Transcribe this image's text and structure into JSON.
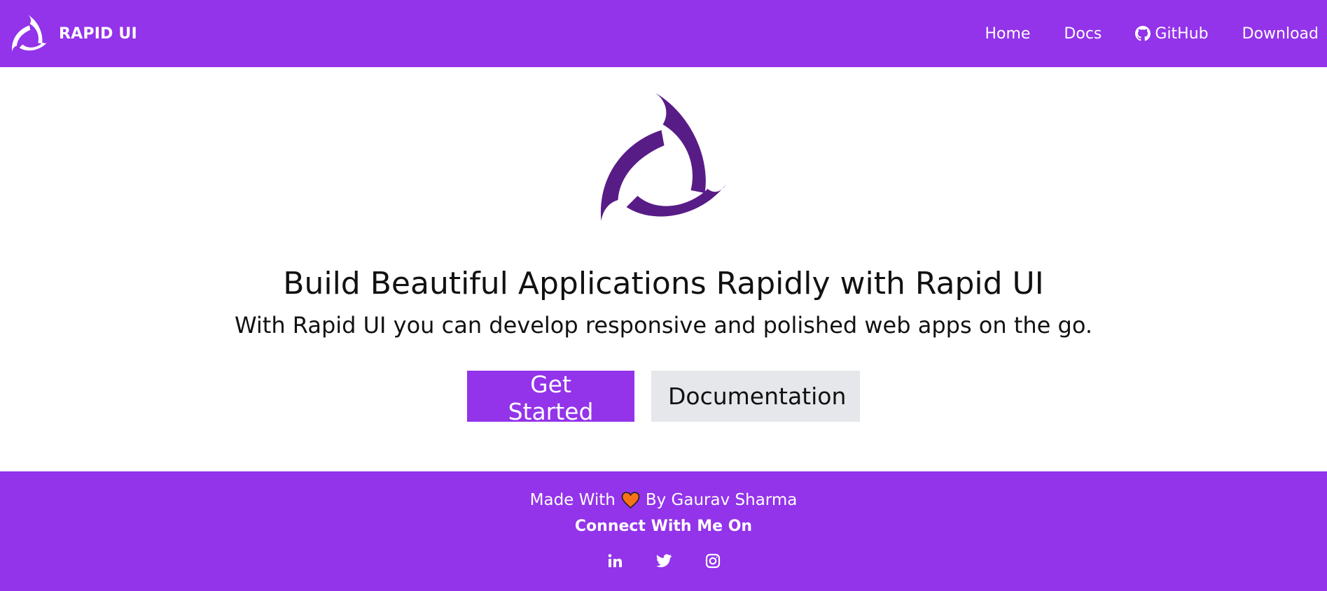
{
  "brand": {
    "name": "RAPID UI",
    "logo_icon": "rapid-ui-logo-icon"
  },
  "nav": {
    "items": [
      {
        "label": "Home"
      },
      {
        "label": "Docs"
      },
      {
        "label": "GitHub",
        "icon": "github-icon"
      },
      {
        "label": "Download"
      }
    ]
  },
  "hero": {
    "logo_icon": "rapid-ui-logo-icon",
    "title": "Build Beautiful Applications Rapidly with Rapid UI",
    "subtitle": "With Rapid UI you can develop responsive and polished web apps on the go.",
    "primary_button": "Get Started",
    "secondary_button": "Documentation"
  },
  "footer": {
    "made_with": "Made With",
    "heart_icon": "heart-icon",
    "by": "By Gaurav Sharma",
    "connect": "Connect With Me On",
    "social": [
      {
        "icon": "linkedin-icon"
      },
      {
        "icon": "twitter-icon"
      },
      {
        "icon": "instagram-icon"
      }
    ]
  },
  "colors": {
    "brand": "#9333ea",
    "logo": "#581c87",
    "secondary_button_bg": "#e5e7eb",
    "heart": "#f97316",
    "text": "#111111"
  }
}
